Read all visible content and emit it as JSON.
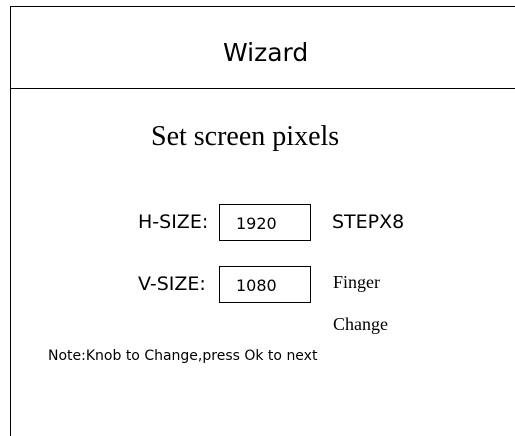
{
  "header": {
    "title": "Wizard"
  },
  "main": {
    "subtitle": "Set screen pixels",
    "h_size": {
      "label": "H-SIZE:",
      "value": "1920",
      "step": "STEPX8"
    },
    "v_size": {
      "label": "V-SIZE:",
      "value": "1080",
      "mode_line1": "Finger",
      "mode_line2": "Change"
    },
    "note": "Note:Knob to Change,press Ok to next"
  }
}
